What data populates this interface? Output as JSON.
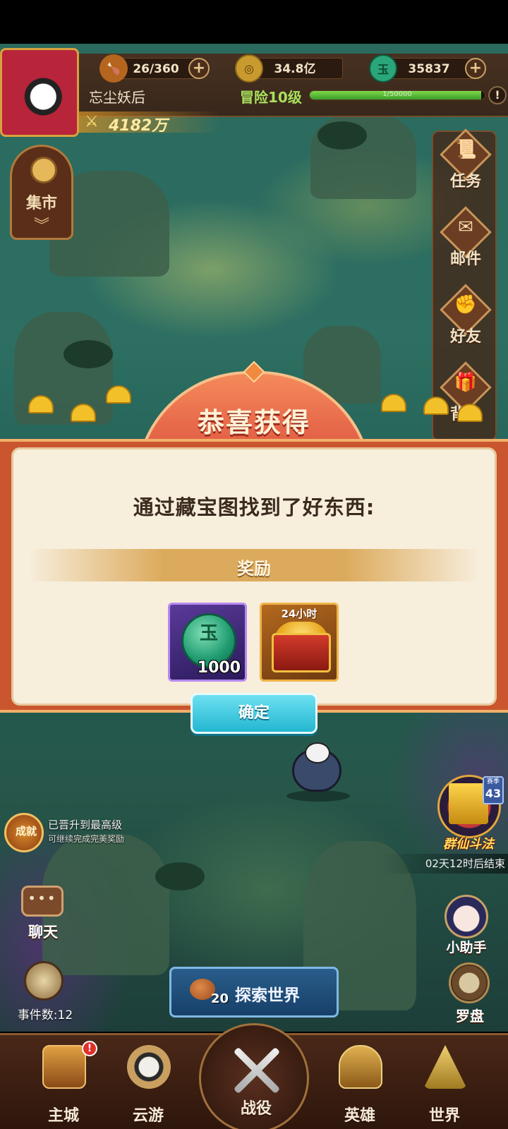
{
  "hud": {
    "stamina": "26/360",
    "coins": "34.8亿",
    "jade": "35837",
    "jade_icon_char": "玉",
    "player_name": "忘尘妖后",
    "adventure_level": "冒险10级",
    "exp_text": "1/50000",
    "exp_progress": 0.98,
    "power": "4182万",
    "warn_char": "!"
  },
  "side_left": {
    "market_label": "集市"
  },
  "side_right": {
    "items": [
      {
        "label": "任务",
        "icon": "scroll-icon"
      },
      {
        "label": "邮件",
        "icon": "mail-icon"
      },
      {
        "label": "好友",
        "icon": "handshake-icon"
      },
      {
        "label": "背包",
        "icon": "bag-icon"
      }
    ]
  },
  "modal": {
    "title": "恭喜获得",
    "message": "通过藏宝图找到了好东西:",
    "reward_label": "奖励",
    "items": [
      {
        "name": "玉",
        "count": "1000",
        "icon": "jade-coin-icon"
      },
      {
        "tag": "24小时",
        "icon": "treasure-chest-icon"
      }
    ],
    "confirm_label": "确定"
  },
  "map_ui": {
    "achievement_icon_text": "成就",
    "achievement_line1": "已晋升到最高级",
    "achievement_line2": "可继续完成完美奖励",
    "event_season_label": "赛季",
    "event_season_num": "43",
    "event_name": "群仙斗法",
    "event_time": "02天12时后结束",
    "chat_label": "聊天",
    "helper_label": "小助手",
    "events_count": "事件数:12",
    "compass_label": "罗盘",
    "explore_cost": "20",
    "explore_label": "探索世界"
  },
  "bottom_nav": {
    "items": [
      {
        "label": "主城",
        "badge": "!"
      },
      {
        "label": "云游"
      },
      {
        "label": "战役"
      },
      {
        "label": "英雄"
      },
      {
        "label": "世界"
      }
    ]
  },
  "colors": {
    "accent_green": "#a9e05b",
    "modal_red": "#c9562e",
    "confirm_cyan": "#22b7d0"
  }
}
